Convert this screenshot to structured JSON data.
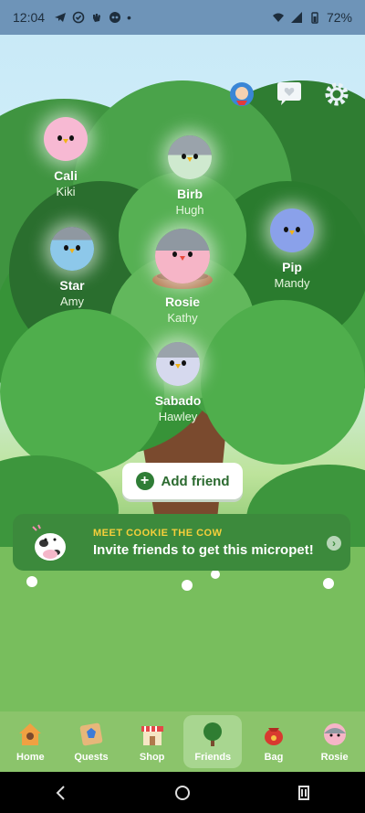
{
  "status": {
    "time": "12:04",
    "battery": "72%",
    "more": "•"
  },
  "pets": [
    {
      "name": "Cali",
      "owner": "Kiki"
    },
    {
      "name": "Birb",
      "owner": "Hugh"
    },
    {
      "name": "Star",
      "owner": "Amy"
    },
    {
      "name": "Rosie",
      "owner": "Kathy"
    },
    {
      "name": "Pip",
      "owner": "Mandy"
    },
    {
      "name": "Sabado",
      "owner": "Hawley"
    }
  ],
  "add_friend": {
    "label": "Add friend"
  },
  "promo": {
    "small": "MEET COOKIE THE COW",
    "big": "Invite friends to get this micropet!"
  },
  "tabs": [
    {
      "label": "Home",
      "icon": "house-icon"
    },
    {
      "label": "Quests",
      "icon": "quest-map-icon"
    },
    {
      "label": "Shop",
      "icon": "shop-icon"
    },
    {
      "label": "Friends",
      "icon": "tree-icon"
    },
    {
      "label": "Bag",
      "icon": "bag-icon"
    },
    {
      "label": "Rosie",
      "icon": "pet-avatar-icon"
    }
  ],
  "colors": {
    "accent": "#2f7d36",
    "promo_bg": "#3c8a3c",
    "tabbar_bg": "#8bc46b"
  }
}
